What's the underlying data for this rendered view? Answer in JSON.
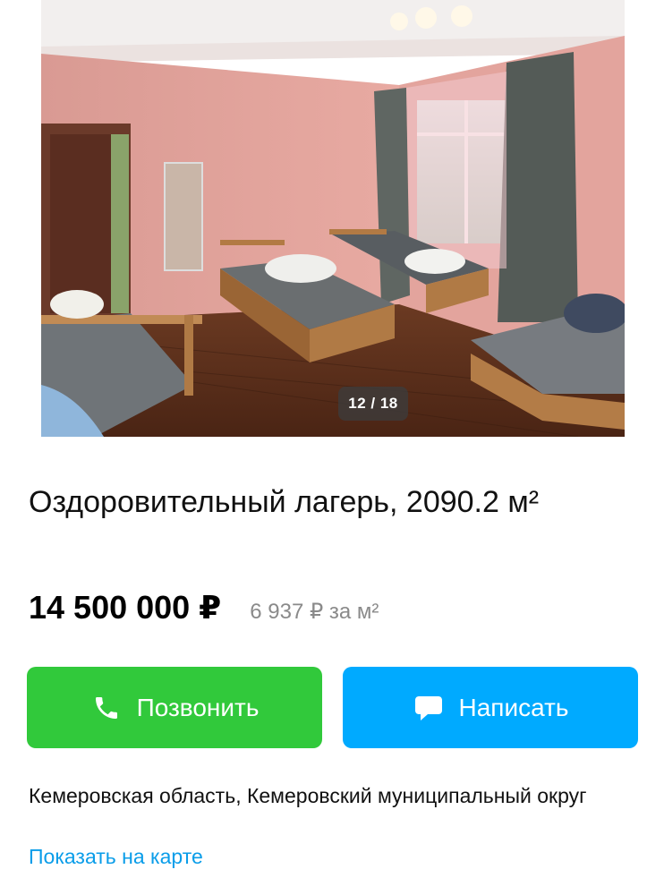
{
  "gallery": {
    "counter": "12 / 18"
  },
  "listing": {
    "title": "Оздоровительный лагерь, 2090.2 м²",
    "price": "14 500 000 ₽",
    "price_per_m2": "6 937 ₽ за м²"
  },
  "actions": {
    "call_label": "Позвонить",
    "call_icon": "phone-icon",
    "message_label": "Написать",
    "message_icon": "chat-bubble-icon",
    "call_color": "#31c93b",
    "message_color": "#00aaff"
  },
  "location": {
    "address": "Кемеровская область, Кемеровский муниципальный округ",
    "map_link": "Показать на карте",
    "link_color": "#0a9de9"
  }
}
